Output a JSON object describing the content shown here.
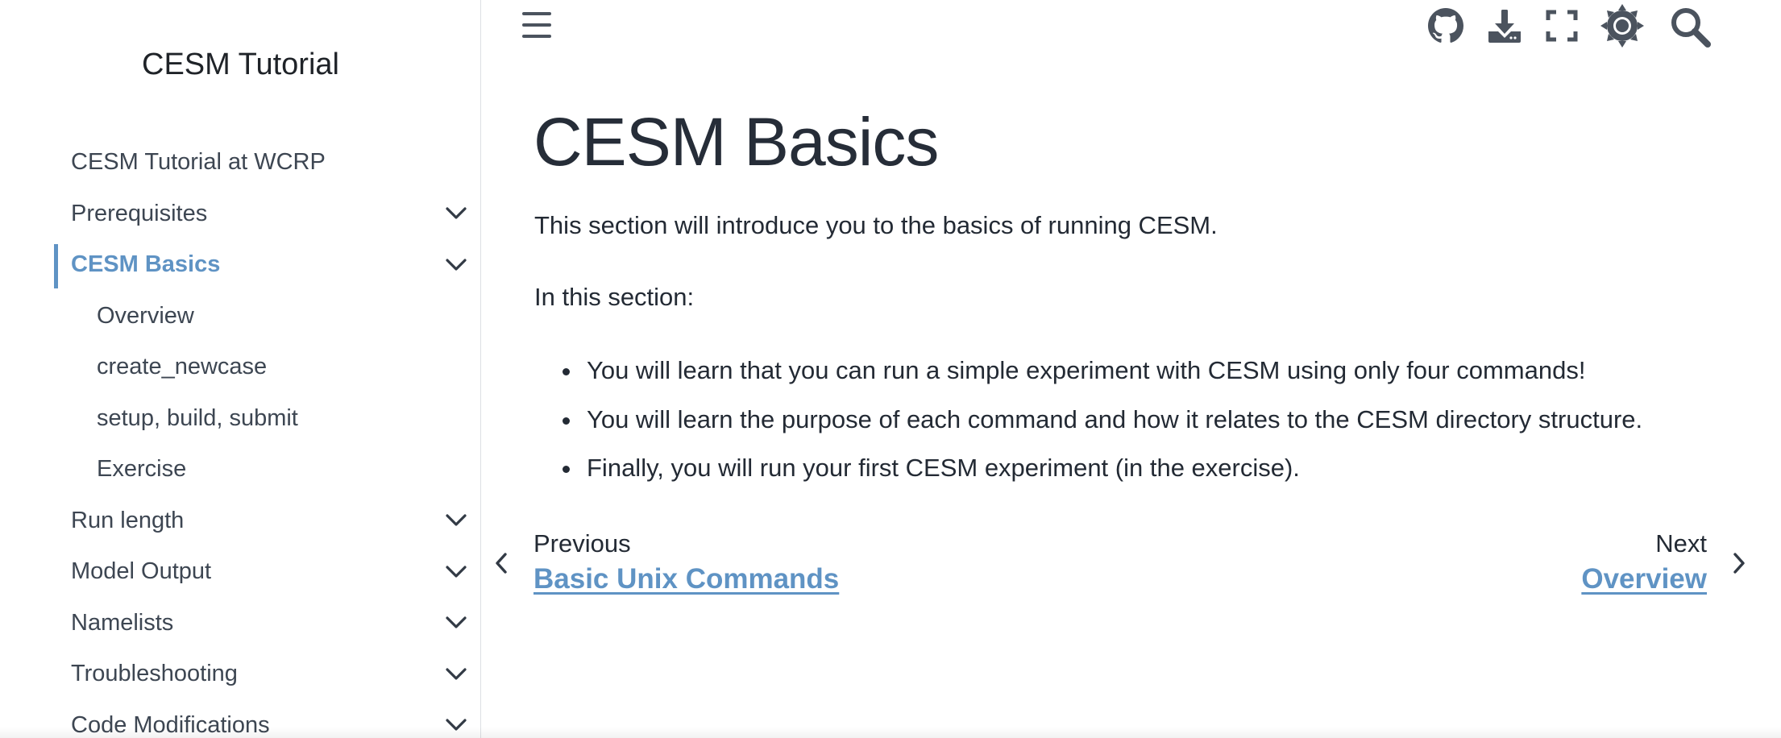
{
  "sidebar": {
    "site_title": "CESM Tutorial",
    "items": [
      {
        "label": "CESM Tutorial at WCRP",
        "expandable": false
      },
      {
        "label": "Prerequisites",
        "expandable": true
      },
      {
        "label": "CESM Basics",
        "expandable": true,
        "active": true
      },
      {
        "label": "Overview",
        "sub": true
      },
      {
        "label": "create_newcase",
        "sub": true
      },
      {
        "label": "setup, build, submit",
        "sub": true
      },
      {
        "label": "Exercise",
        "sub": true
      },
      {
        "label": "Run length",
        "expandable": true
      },
      {
        "label": "Model Output",
        "expandable": true
      },
      {
        "label": "Namelists",
        "expandable": true
      },
      {
        "label": "Troubleshooting",
        "expandable": true
      },
      {
        "label": "Code Modifications",
        "expandable": true
      }
    ]
  },
  "topbar": {
    "icons": [
      "menu-icon",
      "github-icon",
      "download-icon",
      "fullscreen-icon",
      "theme-icon",
      "search-icon"
    ]
  },
  "main": {
    "title": "CESM Basics",
    "intro": "This section will introduce you to the basics of running CESM.",
    "section_label": "In this section:",
    "bullets": [
      "You will learn that you can run a simple experiment with CESM using only four commands!",
      "You will learn the purpose of each command and how it relates to the CESM directory structure.",
      "Finally, you will run your first CESM experiment (in the exercise)."
    ]
  },
  "prev_next": {
    "prev_caption": "Previous",
    "prev_title": "Basic Unix Commands",
    "next_caption": "Next",
    "next_title": "Overview"
  },
  "colors": {
    "accent": "#5f93c4",
    "text": "#232a34",
    "nav_text": "#3d4652"
  }
}
